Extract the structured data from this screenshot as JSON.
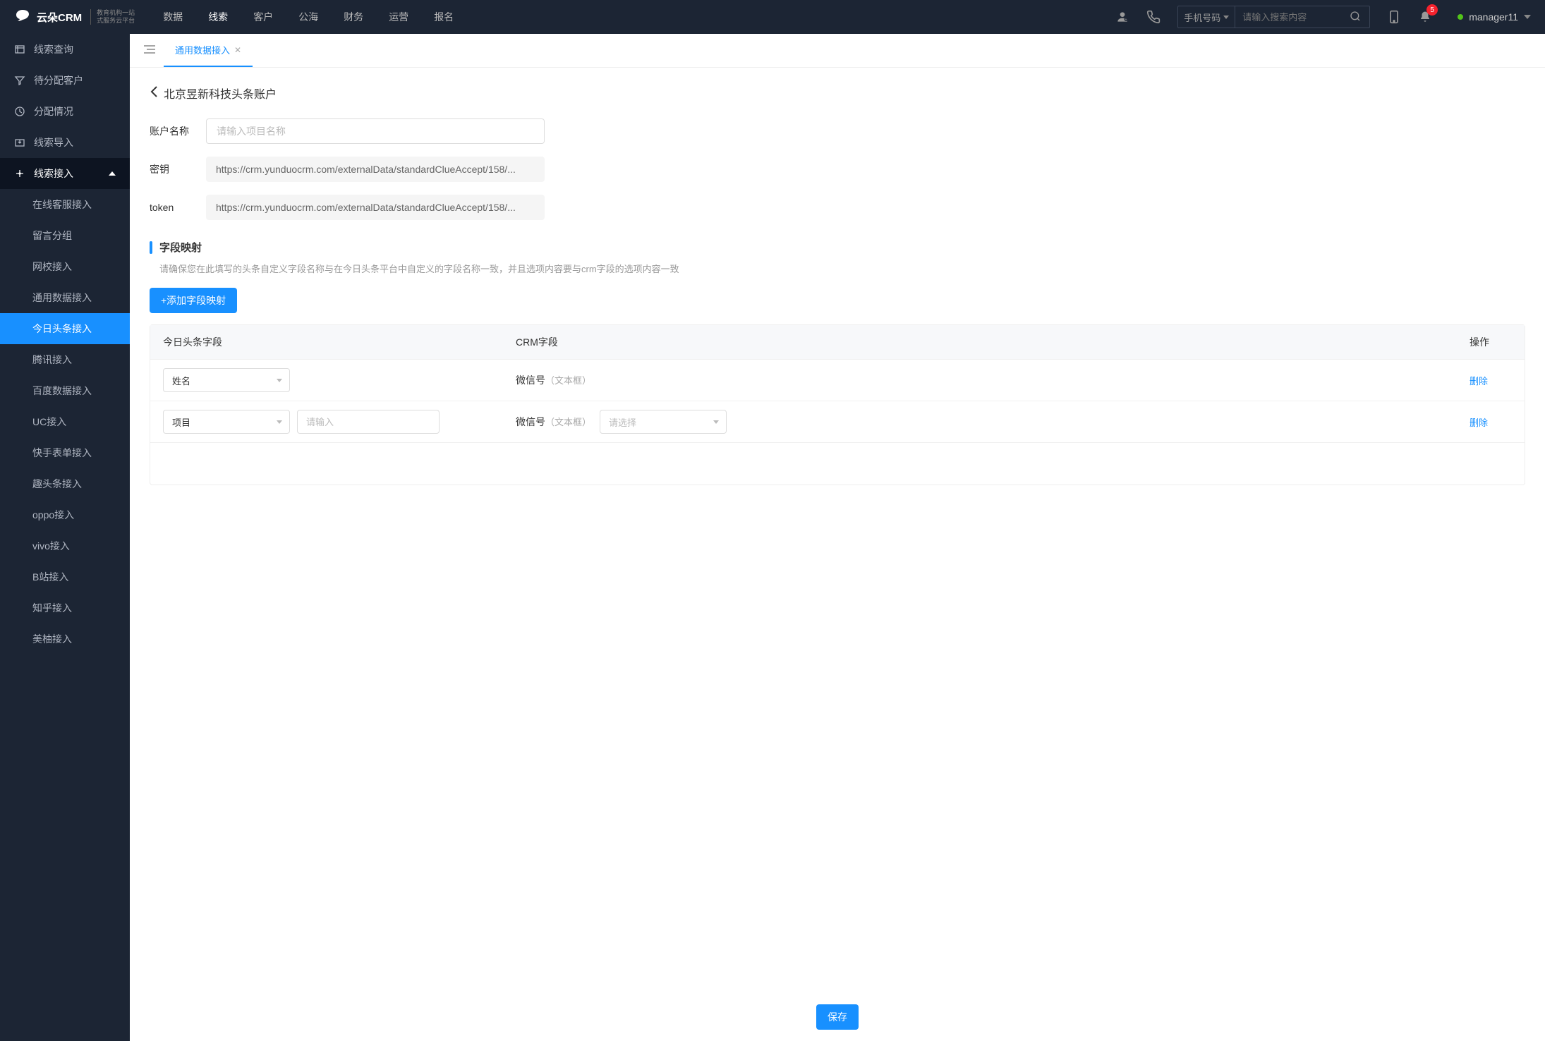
{
  "header": {
    "logo_text": "云朵CRM",
    "logo_sub1": "教育机构一站",
    "logo_sub2": "式服务云平台",
    "nav": [
      "数据",
      "线索",
      "客户",
      "公海",
      "财务",
      "运营",
      "报名"
    ],
    "nav_active_index": 1,
    "search_select": "手机号码",
    "search_placeholder": "请输入搜索内容",
    "badge_count": "5",
    "username": "manager11"
  },
  "sidebar": {
    "items": [
      {
        "label": "线索查询"
      },
      {
        "label": "待分配客户"
      },
      {
        "label": "分配情况"
      },
      {
        "label": "线索导入"
      },
      {
        "label": "线索接入",
        "expanded": true
      }
    ],
    "subitems": [
      {
        "label": "在线客服接入"
      },
      {
        "label": "留言分组"
      },
      {
        "label": "网校接入"
      },
      {
        "label": "通用数据接入"
      },
      {
        "label": "今日头条接入",
        "active": true
      },
      {
        "label": "腾讯接入"
      },
      {
        "label": "百度数据接入"
      },
      {
        "label": "UC接入"
      },
      {
        "label": "快手表单接入"
      },
      {
        "label": "趣头条接入"
      },
      {
        "label": "oppo接入"
      },
      {
        "label": "vivo接入"
      },
      {
        "label": "B站接入"
      },
      {
        "label": "知乎接入"
      },
      {
        "label": "美柚接入"
      }
    ]
  },
  "tab": {
    "label": "通用数据接入"
  },
  "page": {
    "title": "北京昱新科技头条账户",
    "form": {
      "account_label": "账户名称",
      "account_placeholder": "请输入项目名称",
      "key_label": "密钥",
      "key_value": "https://crm.yunduocrm.com/externalData/standardClueAccept/158/...",
      "token_label": "token",
      "token_value": "https://crm.yunduocrm.com/externalData/standardClueAccept/158/..."
    },
    "section_title": "字段映射",
    "section_hint": "请确保您在此填写的头条自定义字段名称与在今日头条平台中自定义的字段名称一致，并且选项内容要与crm字段的选项内容一致",
    "add_btn": "+添加字段映射",
    "table": {
      "headers": [
        "今日头条字段",
        "CRM字段",
        "操作"
      ],
      "rows": [
        {
          "select1": "姓名",
          "crm": "微信号",
          "crm_hint": "（文本框）",
          "del": "删除"
        },
        {
          "select1": "项目",
          "input_ph": "请输入",
          "crm": "微信号",
          "crm_hint": "（文本框）",
          "select2_ph": "请选择",
          "del": "删除"
        }
      ]
    },
    "save_btn": "保存"
  }
}
